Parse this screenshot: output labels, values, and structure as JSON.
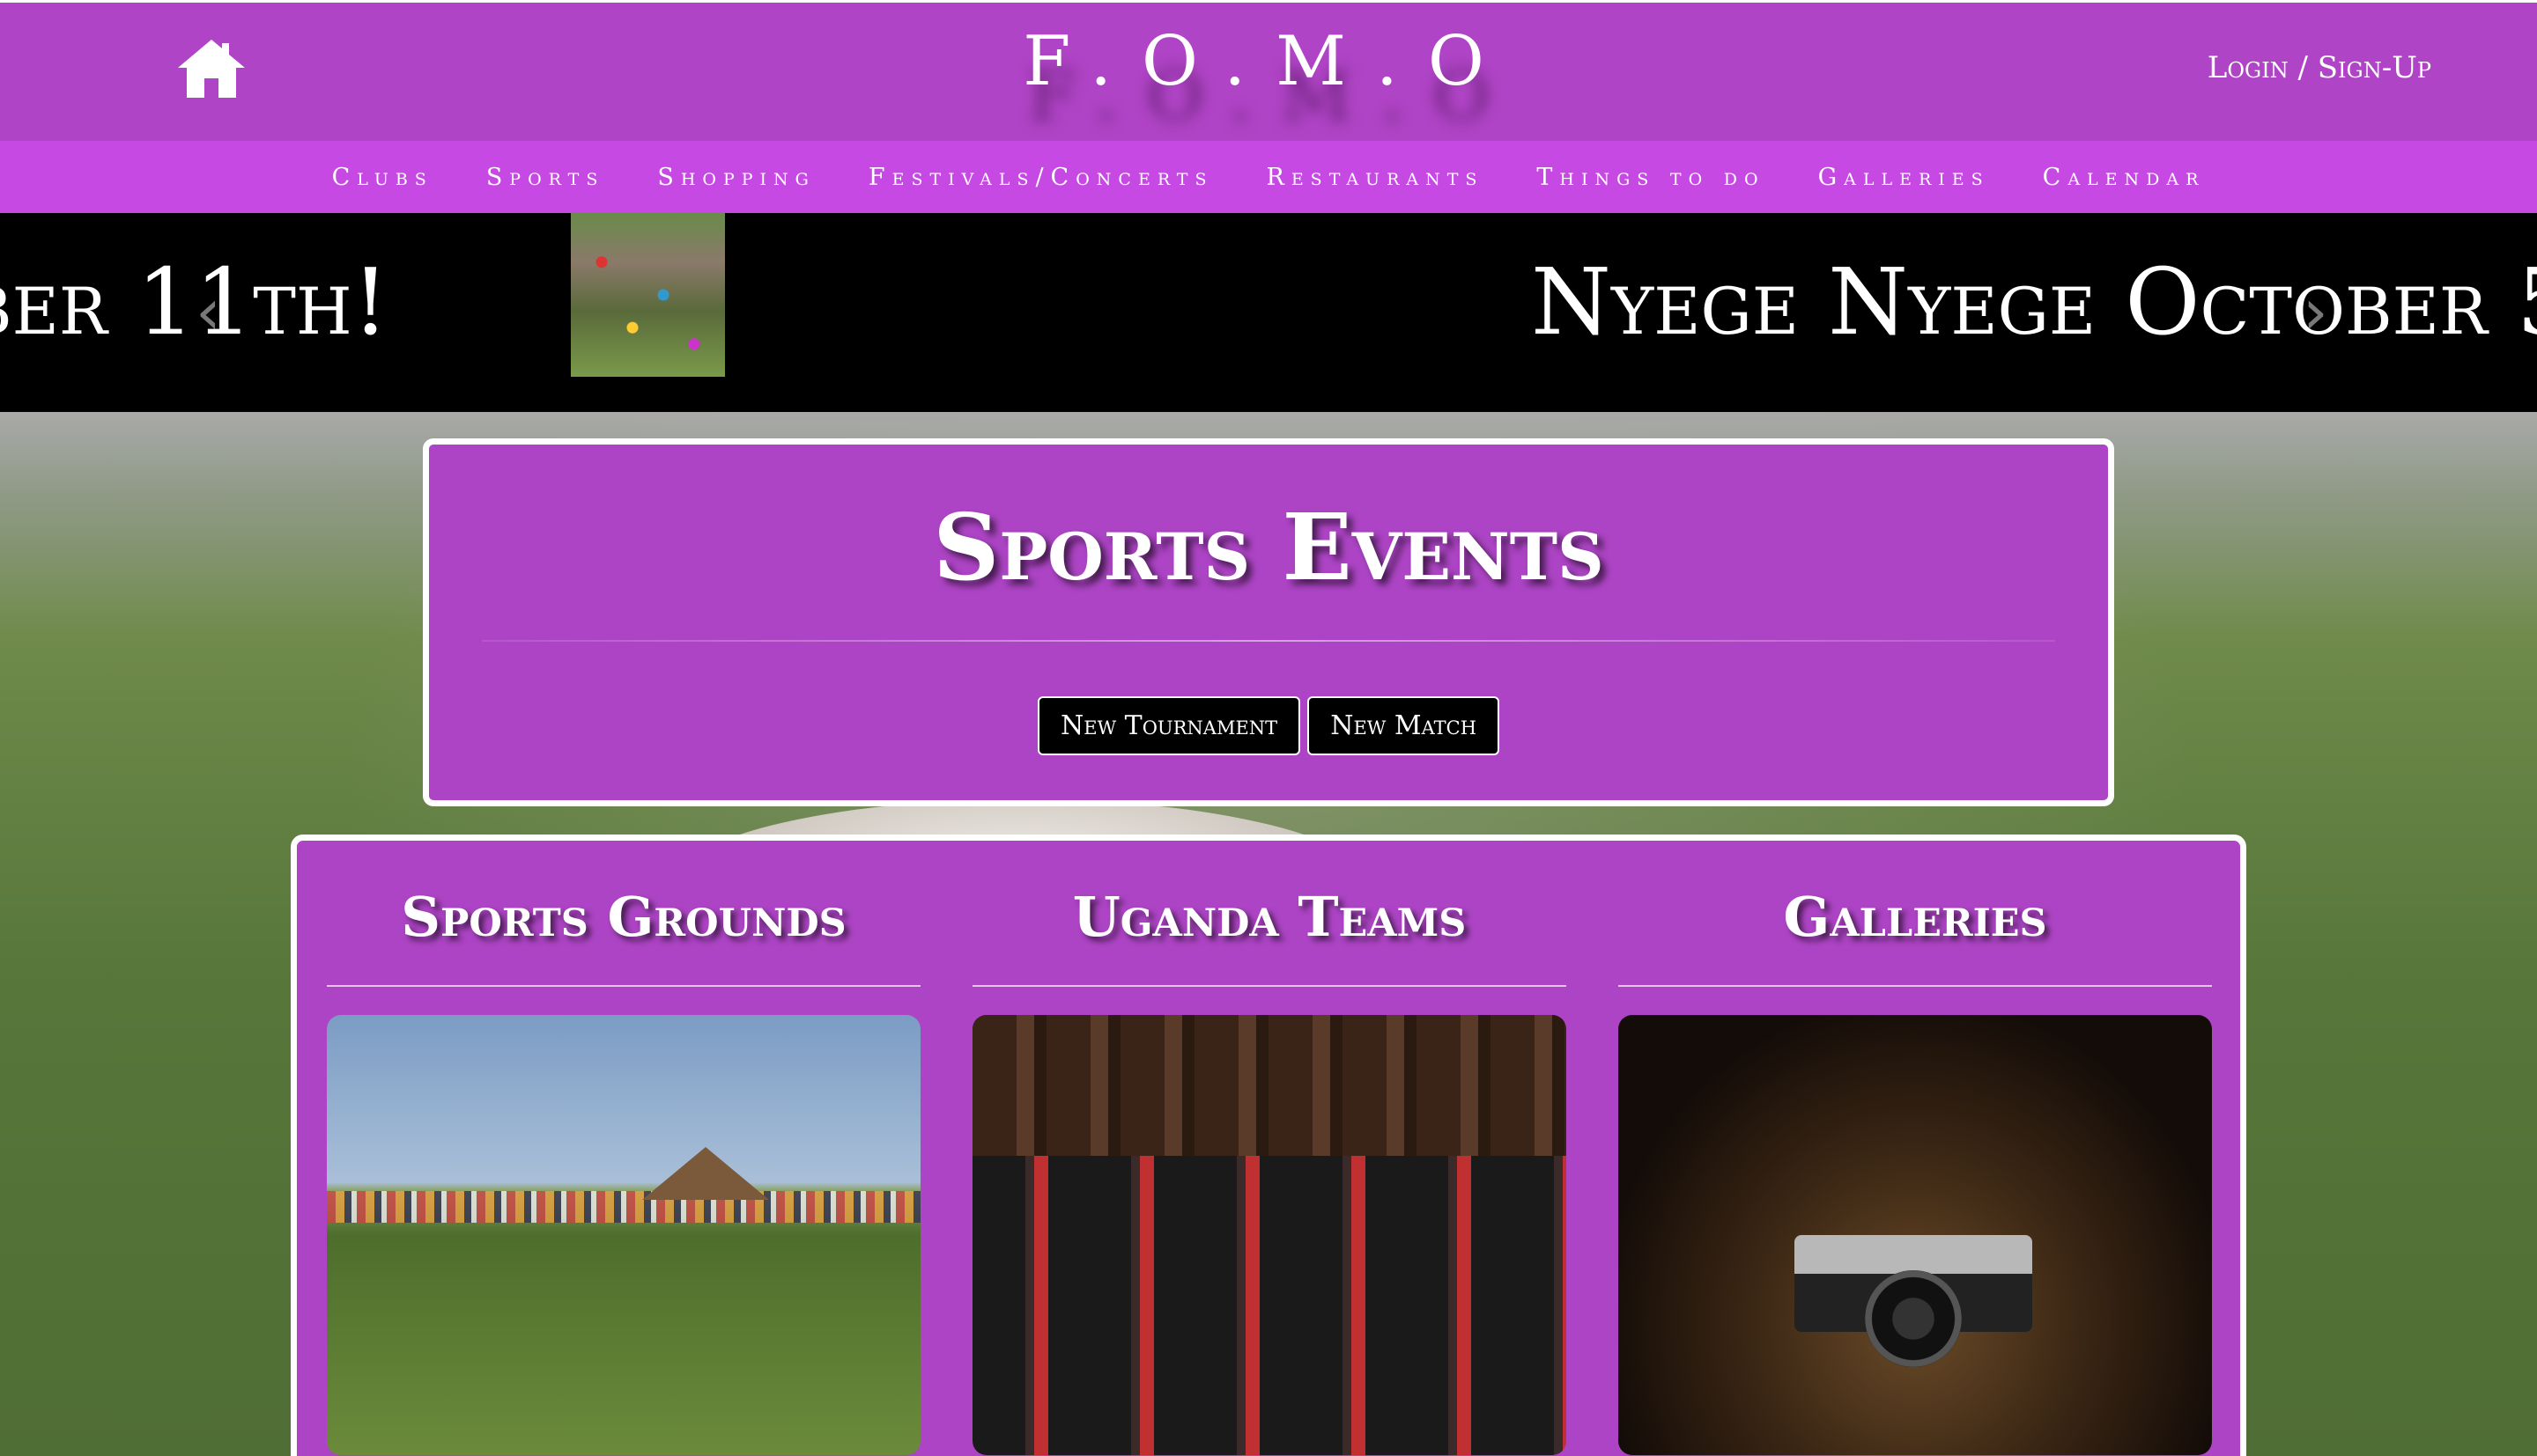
{
  "header": {
    "logo": "F.O.M.O",
    "login_label": "Login / Sign-Up"
  },
  "nav": {
    "items": [
      {
        "label": "Clubs"
      },
      {
        "label": "Sports"
      },
      {
        "label": "Shopping"
      },
      {
        "label": "Festivals/Concerts"
      },
      {
        "label": "Restaurants"
      },
      {
        "label": "Things to do"
      },
      {
        "label": "Galleries"
      },
      {
        "label": "Calendar"
      }
    ]
  },
  "banner": {
    "left_text": "ber 11th!",
    "right_text": "Nyege Nyege October 5",
    "prev_icon": "chevron-left-icon",
    "next_icon": "chevron-right-icon"
  },
  "events": {
    "title": "Sports Events",
    "buttons": [
      {
        "label": "New Tournament"
      },
      {
        "label": "New Match"
      }
    ]
  },
  "cards": [
    {
      "title": "Sports Grounds"
    },
    {
      "title": "Uganda Teams"
    },
    {
      "title": "Galleries"
    }
  ],
  "colors": {
    "header_purple": "#b044c6",
    "nav_purple": "#c649e3",
    "panel_purple": "#ad44c5"
  }
}
